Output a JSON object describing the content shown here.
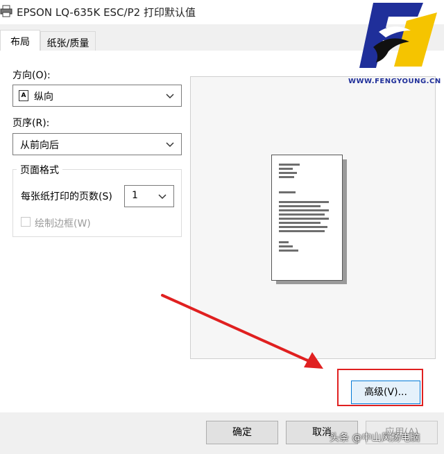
{
  "window": {
    "title": "EPSON LQ-635K ESC/P2 打印默认值"
  },
  "tabs": [
    {
      "label": "布局",
      "active": true
    },
    {
      "label": "纸张/质量",
      "active": false
    }
  ],
  "layout": {
    "orientation": {
      "label": "方向(O):",
      "value": "纵向",
      "icon_letter": "A"
    },
    "page_order": {
      "label": "页序(R):",
      "value": "从前向后"
    },
    "page_format": {
      "group_title": "页面格式",
      "pages_per_sheet": {
        "label": "每张纸打印的页数(S)",
        "value": "1"
      },
      "draw_borders": {
        "label": "绘制边框(W)",
        "checked": false,
        "disabled": true
      }
    }
  },
  "buttons": {
    "advanced": "高级(V)...",
    "ok": "确定",
    "cancel": "取消",
    "apply": "应用(A)"
  },
  "logo": {
    "text": "WWW.FENGYOUNG.CN"
  },
  "watermark": "头条 @中山风扬电脑",
  "colors": {
    "highlight": "#e02020",
    "arrow": "#e02020",
    "logo_blue": "#1f2f9a",
    "logo_yellow": "#f5c400"
  }
}
